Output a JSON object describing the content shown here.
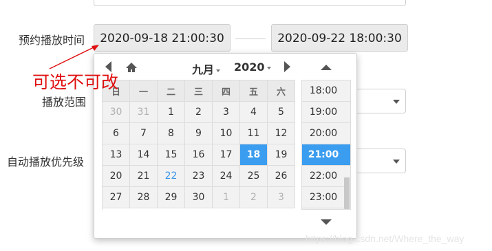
{
  "form": {
    "row1_label": "预约播放时间",
    "start_datetime": "2020-09-18 21:00:30",
    "end_datetime": "2020-09-22 18:00:30",
    "row2_label": "播放范围",
    "row3_label": "自动播放优先级"
  },
  "annotation": "可选不可改",
  "calendar": {
    "month": "九月",
    "year": "2020",
    "weekdays": [
      "日",
      "一",
      "二",
      "三",
      "四",
      "五",
      "六"
    ],
    "weeks": [
      [
        {
          "d": "30",
          "s": "muted"
        },
        {
          "d": "31",
          "s": "muted"
        },
        {
          "d": "1"
        },
        {
          "d": "2"
        },
        {
          "d": "3"
        },
        {
          "d": "4"
        },
        {
          "d": "5"
        }
      ],
      [
        {
          "d": "6"
        },
        {
          "d": "7"
        },
        {
          "d": "8"
        },
        {
          "d": "9"
        },
        {
          "d": "10"
        },
        {
          "d": "11"
        },
        {
          "d": "12"
        }
      ],
      [
        {
          "d": "13"
        },
        {
          "d": "14"
        },
        {
          "d": "15"
        },
        {
          "d": "16"
        },
        {
          "d": "17"
        },
        {
          "d": "18",
          "s": "sel"
        },
        {
          "d": "19"
        }
      ],
      [
        {
          "d": "20"
        },
        {
          "d": "21"
        },
        {
          "d": "22",
          "s": "today"
        },
        {
          "d": "23"
        },
        {
          "d": "24"
        },
        {
          "d": "25"
        },
        {
          "d": "26"
        }
      ],
      [
        {
          "d": "27"
        },
        {
          "d": "28"
        },
        {
          "d": "29"
        },
        {
          "d": "30"
        },
        {
          "d": "1",
          "s": "muted"
        },
        {
          "d": "2",
          "s": "muted"
        },
        {
          "d": "3",
          "s": "muted"
        }
      ]
    ],
    "times": [
      "18:00",
      "19:00",
      "20:00",
      "21:00",
      "22:00",
      "23:00"
    ],
    "selected_time": "21:00"
  },
  "watermark": "https://blog.csdn.net/Where_the_way",
  "colors": {
    "accent": "#3b9df0",
    "annotation": "#e01010"
  }
}
